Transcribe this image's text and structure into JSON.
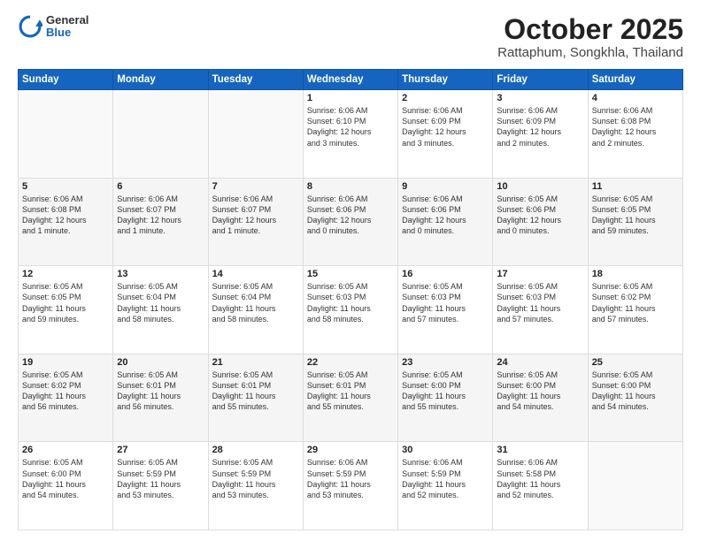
{
  "header": {
    "logo_general": "General",
    "logo_blue": "Blue",
    "month_year": "October 2025",
    "location": "Rattaphum, Songkhla, Thailand"
  },
  "weekdays": [
    "Sunday",
    "Monday",
    "Tuesday",
    "Wednesday",
    "Thursday",
    "Friday",
    "Saturday"
  ],
  "weeks": [
    [
      {
        "day": "",
        "info": ""
      },
      {
        "day": "",
        "info": ""
      },
      {
        "day": "",
        "info": ""
      },
      {
        "day": "1",
        "info": "Sunrise: 6:06 AM\nSunset: 6:10 PM\nDaylight: 12 hours\nand 3 minutes."
      },
      {
        "day": "2",
        "info": "Sunrise: 6:06 AM\nSunset: 6:09 PM\nDaylight: 12 hours\nand 3 minutes."
      },
      {
        "day": "3",
        "info": "Sunrise: 6:06 AM\nSunset: 6:09 PM\nDaylight: 12 hours\nand 2 minutes."
      },
      {
        "day": "4",
        "info": "Sunrise: 6:06 AM\nSunset: 6:08 PM\nDaylight: 12 hours\nand 2 minutes."
      }
    ],
    [
      {
        "day": "5",
        "info": "Sunrise: 6:06 AM\nSunset: 6:08 PM\nDaylight: 12 hours\nand 1 minute."
      },
      {
        "day": "6",
        "info": "Sunrise: 6:06 AM\nSunset: 6:07 PM\nDaylight: 12 hours\nand 1 minute."
      },
      {
        "day": "7",
        "info": "Sunrise: 6:06 AM\nSunset: 6:07 PM\nDaylight: 12 hours\nand 1 minute."
      },
      {
        "day": "8",
        "info": "Sunrise: 6:06 AM\nSunset: 6:06 PM\nDaylight: 12 hours\nand 0 minutes."
      },
      {
        "day": "9",
        "info": "Sunrise: 6:06 AM\nSunset: 6:06 PM\nDaylight: 12 hours\nand 0 minutes."
      },
      {
        "day": "10",
        "info": "Sunrise: 6:05 AM\nSunset: 6:06 PM\nDaylight: 12 hours\nand 0 minutes."
      },
      {
        "day": "11",
        "info": "Sunrise: 6:05 AM\nSunset: 6:05 PM\nDaylight: 11 hours\nand 59 minutes."
      }
    ],
    [
      {
        "day": "12",
        "info": "Sunrise: 6:05 AM\nSunset: 6:05 PM\nDaylight: 11 hours\nand 59 minutes."
      },
      {
        "day": "13",
        "info": "Sunrise: 6:05 AM\nSunset: 6:04 PM\nDaylight: 11 hours\nand 58 minutes."
      },
      {
        "day": "14",
        "info": "Sunrise: 6:05 AM\nSunset: 6:04 PM\nDaylight: 11 hours\nand 58 minutes."
      },
      {
        "day": "15",
        "info": "Sunrise: 6:05 AM\nSunset: 6:03 PM\nDaylight: 11 hours\nand 58 minutes."
      },
      {
        "day": "16",
        "info": "Sunrise: 6:05 AM\nSunset: 6:03 PM\nDaylight: 11 hours\nand 57 minutes."
      },
      {
        "day": "17",
        "info": "Sunrise: 6:05 AM\nSunset: 6:03 PM\nDaylight: 11 hours\nand 57 minutes."
      },
      {
        "day": "18",
        "info": "Sunrise: 6:05 AM\nSunset: 6:02 PM\nDaylight: 11 hours\nand 57 minutes."
      }
    ],
    [
      {
        "day": "19",
        "info": "Sunrise: 6:05 AM\nSunset: 6:02 PM\nDaylight: 11 hours\nand 56 minutes."
      },
      {
        "day": "20",
        "info": "Sunrise: 6:05 AM\nSunset: 6:01 PM\nDaylight: 11 hours\nand 56 minutes."
      },
      {
        "day": "21",
        "info": "Sunrise: 6:05 AM\nSunset: 6:01 PM\nDaylight: 11 hours\nand 55 minutes."
      },
      {
        "day": "22",
        "info": "Sunrise: 6:05 AM\nSunset: 6:01 PM\nDaylight: 11 hours\nand 55 minutes."
      },
      {
        "day": "23",
        "info": "Sunrise: 6:05 AM\nSunset: 6:00 PM\nDaylight: 11 hours\nand 55 minutes."
      },
      {
        "day": "24",
        "info": "Sunrise: 6:05 AM\nSunset: 6:00 PM\nDaylight: 11 hours\nand 54 minutes."
      },
      {
        "day": "25",
        "info": "Sunrise: 6:05 AM\nSunset: 6:00 PM\nDaylight: 11 hours\nand 54 minutes."
      }
    ],
    [
      {
        "day": "26",
        "info": "Sunrise: 6:05 AM\nSunset: 6:00 PM\nDaylight: 11 hours\nand 54 minutes."
      },
      {
        "day": "27",
        "info": "Sunrise: 6:05 AM\nSunset: 5:59 PM\nDaylight: 11 hours\nand 53 minutes."
      },
      {
        "day": "28",
        "info": "Sunrise: 6:05 AM\nSunset: 5:59 PM\nDaylight: 11 hours\nand 53 minutes."
      },
      {
        "day": "29",
        "info": "Sunrise: 6:06 AM\nSunset: 5:59 PM\nDaylight: 11 hours\nand 53 minutes."
      },
      {
        "day": "30",
        "info": "Sunrise: 6:06 AM\nSunset: 5:59 PM\nDaylight: 11 hours\nand 52 minutes."
      },
      {
        "day": "31",
        "info": "Sunrise: 6:06 AM\nSunset: 5:58 PM\nDaylight: 11 hours\nand 52 minutes."
      },
      {
        "day": "",
        "info": ""
      }
    ]
  ]
}
